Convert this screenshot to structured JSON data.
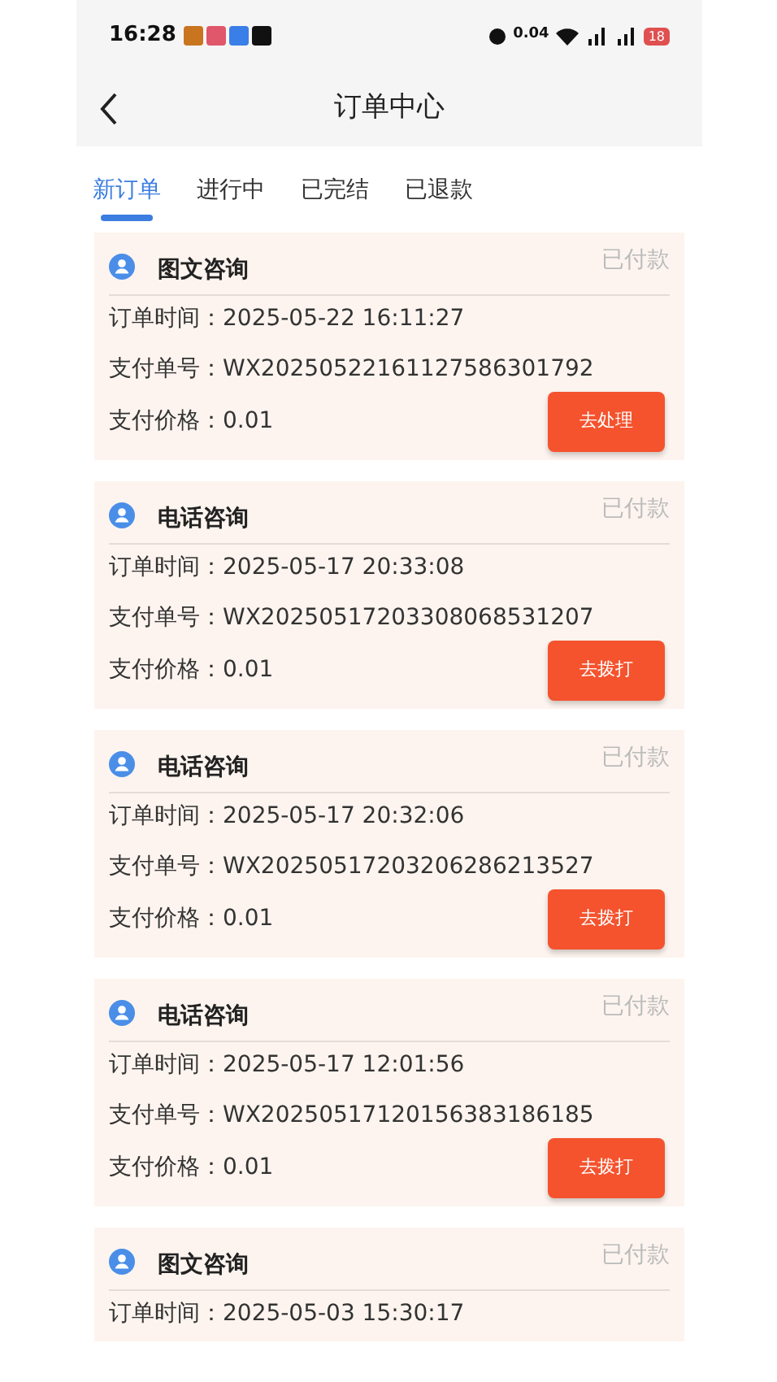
{
  "status_bar": {
    "time": "16:28",
    "net_speed": "0.04",
    "battery": "18"
  },
  "header": {
    "title": "订单中心"
  },
  "tabs": [
    {
      "label": "新订单",
      "selected": true
    },
    {
      "label": "进行中",
      "selected": false
    },
    {
      "label": "已完结",
      "selected": false
    },
    {
      "label": "已退款",
      "selected": false
    }
  ],
  "orders": [
    {
      "type": "图文咨询",
      "status": "已付款",
      "time_label": "订单时间：",
      "time": "2025-05-22 16:11:27",
      "no_label": "支付单号：",
      "no": "WX20250522161127586301792",
      "price_label": "支付价格：",
      "price": "0.01",
      "action": "去处理"
    },
    {
      "type": "电话咨询",
      "status": "已付款",
      "time_label": "订单时间：",
      "time": "2025-05-17 20:33:08",
      "no_label": "支付单号：",
      "no": "WX20250517203308068531207",
      "price_label": "支付价格：",
      "price": "0.01",
      "action": "去拨打"
    },
    {
      "type": "电话咨询",
      "status": "已付款",
      "time_label": "订单时间：",
      "time": "2025-05-17 20:32:06",
      "no_label": "支付单号：",
      "no": "WX20250517203206286213527",
      "price_label": "支付价格：",
      "price": "0.01",
      "action": "去拨打"
    },
    {
      "type": "电话咨询",
      "status": "已付款",
      "time_label": "订单时间：",
      "time": "2025-05-17 12:01:56",
      "no_label": "支付单号：",
      "no": "WX20250517120156383186185",
      "price_label": "支付价格：",
      "price": "0.01",
      "action": "去拨打"
    },
    {
      "type": "图文咨询",
      "status": "已付款",
      "time_label": "订单时间：",
      "time": "2025-05-03 15:30:17"
    }
  ]
}
